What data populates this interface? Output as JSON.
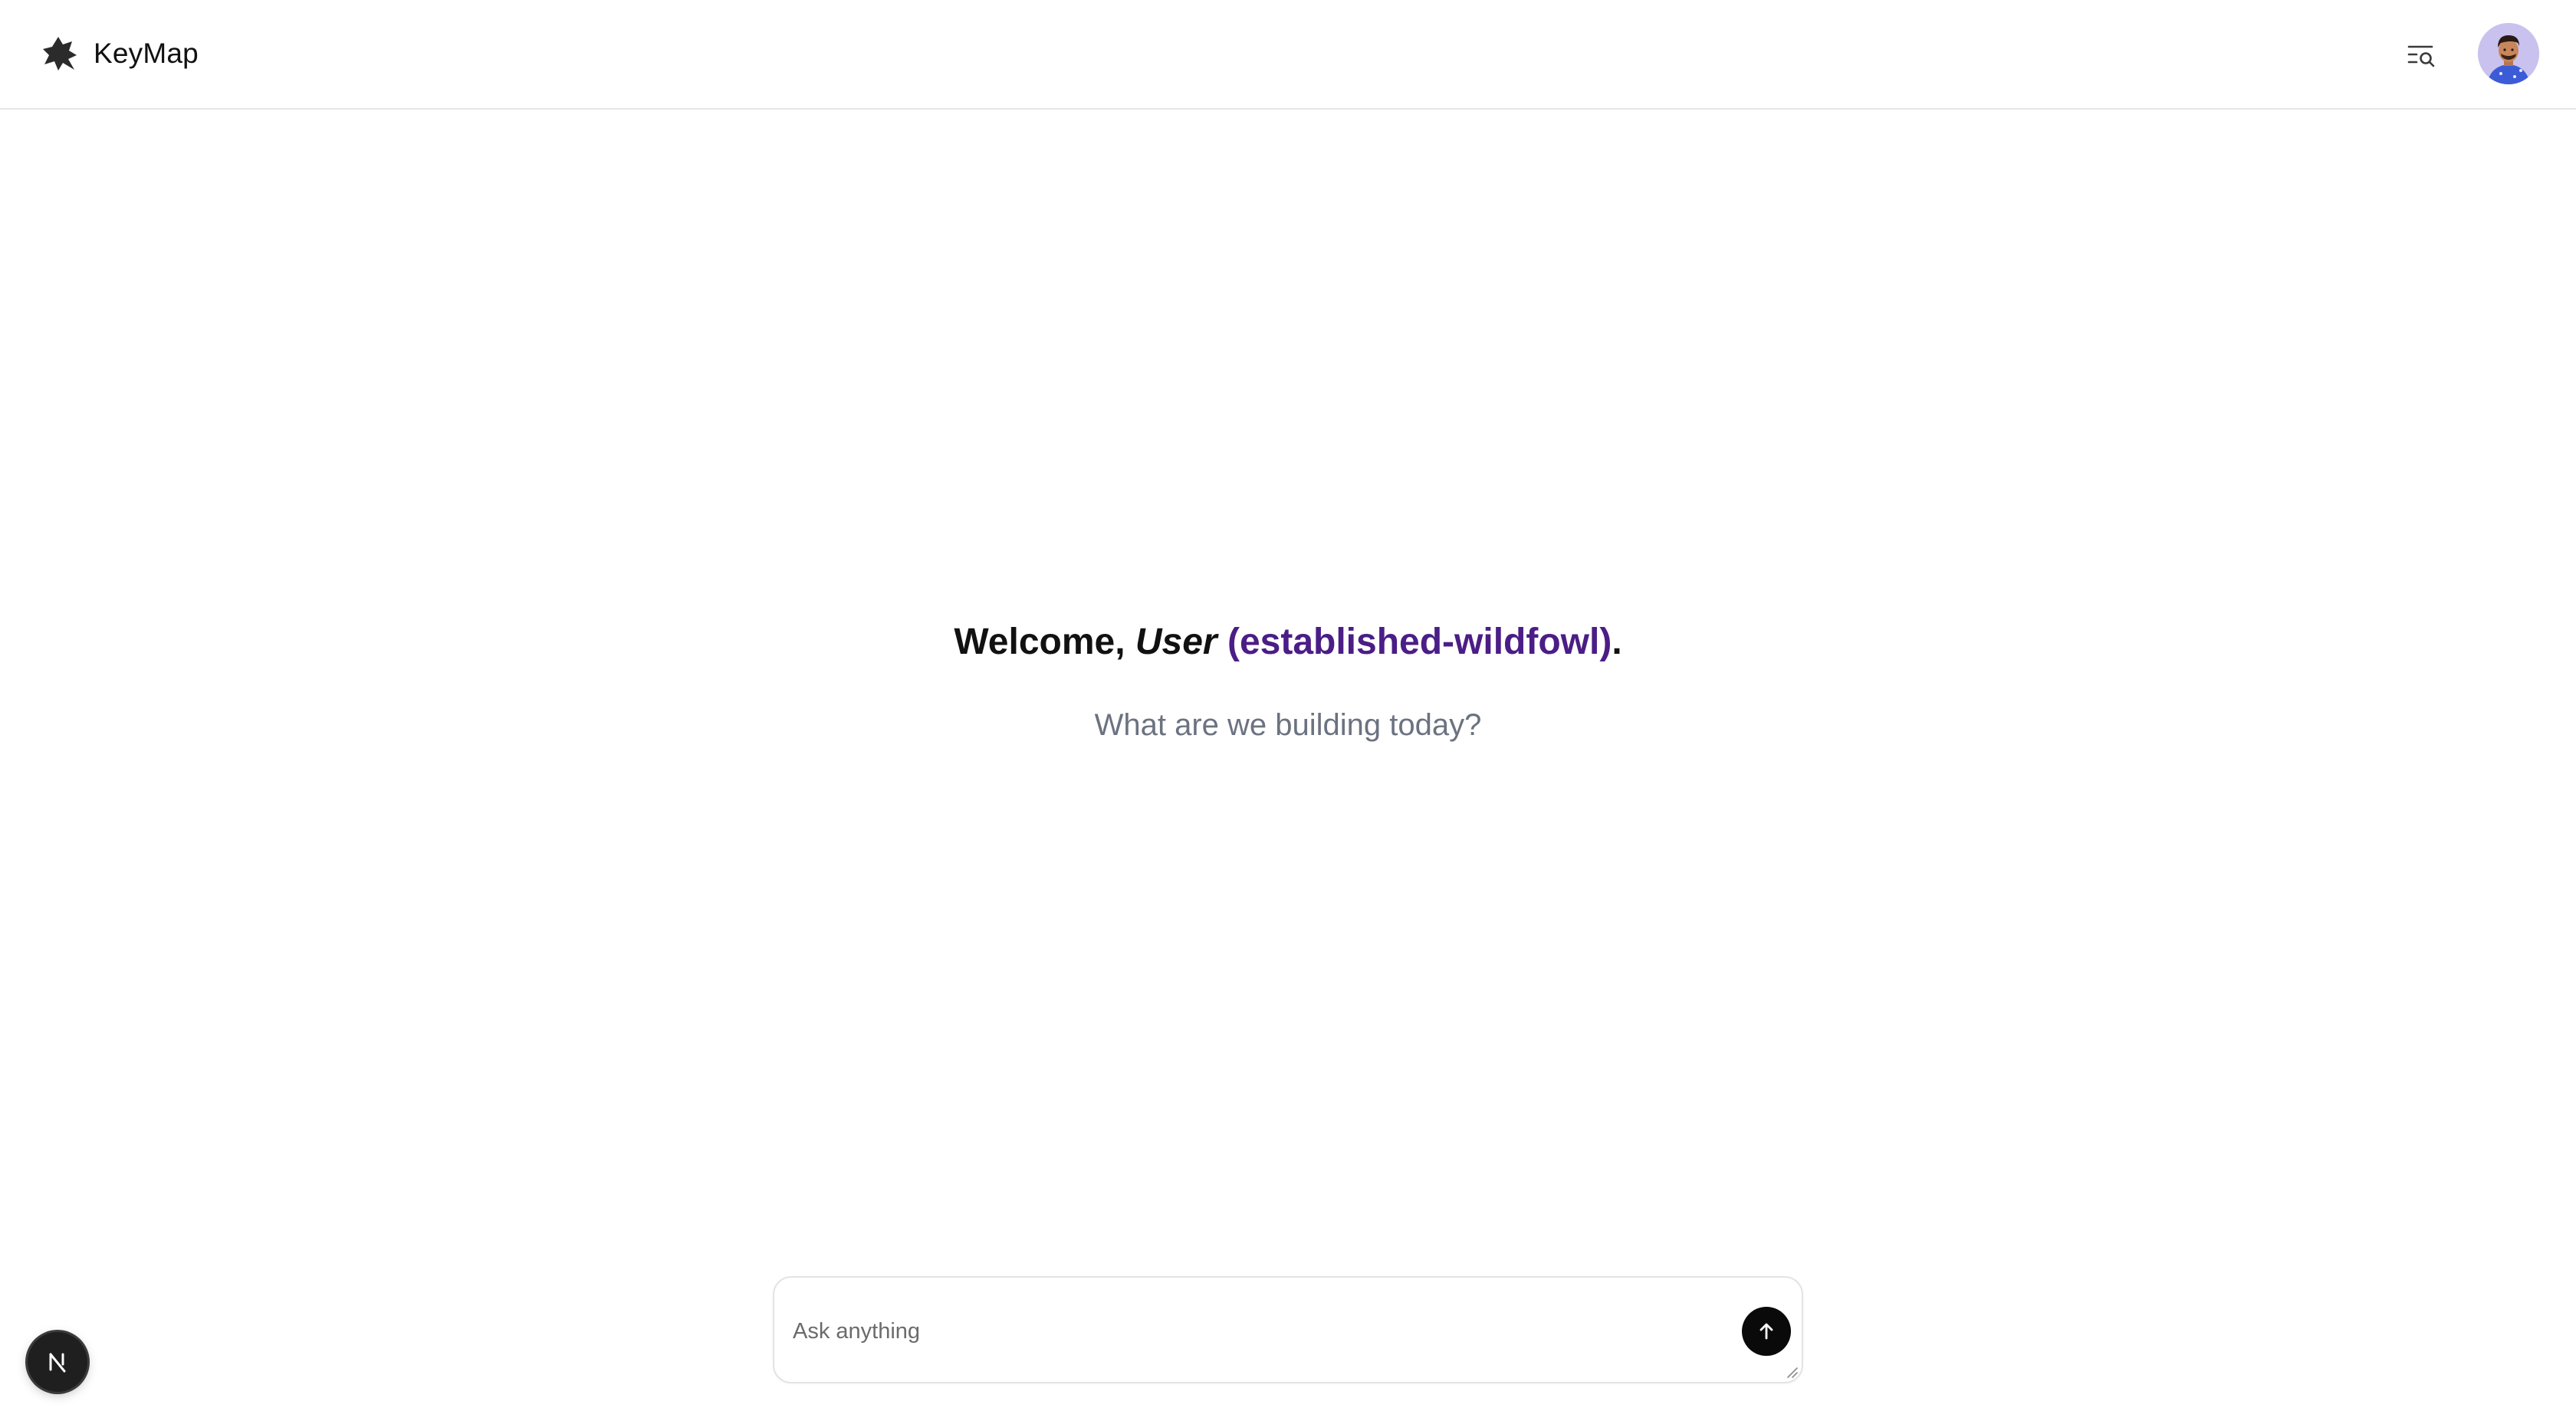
{
  "header": {
    "app_name": "KeyMap",
    "logo_icon": "star-badge-icon",
    "history_icon": "list-search-icon",
    "avatar_icon": "user-avatar"
  },
  "hero": {
    "welcome_prefix": "Welcome, ",
    "user_name": "User",
    "user_handle": "(established-wildfowl)",
    "welcome_suffix": ".",
    "subtitle": "What are we building today?"
  },
  "composer": {
    "placeholder": "Ask anything",
    "value": "",
    "send_icon": "arrow-up-icon"
  },
  "dev_badge": {
    "letter": "N",
    "icon": "nextjs-icon"
  },
  "colors": {
    "accent_handle": "#4b1d86",
    "subtitle": "#6b7280",
    "send_button": "#0a0a0a",
    "divider": "#e6e6e9"
  }
}
